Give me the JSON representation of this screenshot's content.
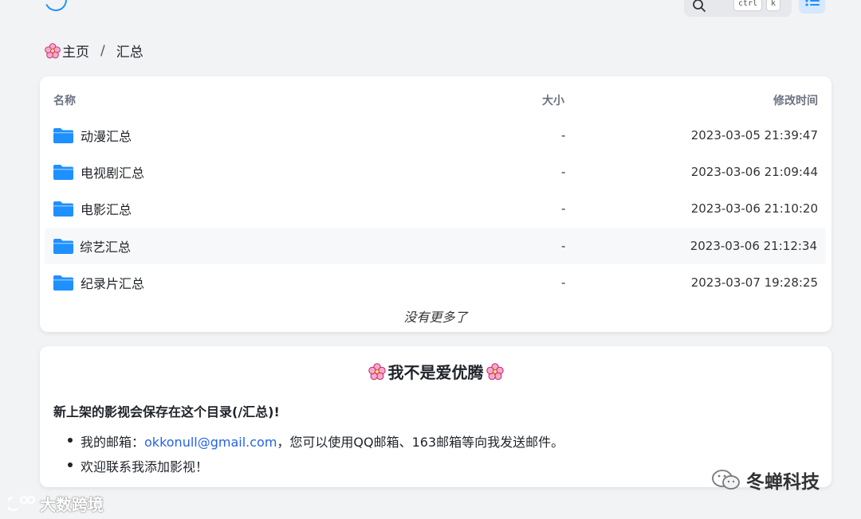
{
  "topbar": {
    "shortcut_keys": [
      "ctrl",
      "k"
    ]
  },
  "breadcrumb": {
    "home_label": "主页",
    "separator": "/",
    "current_label": "汇总"
  },
  "file_list": {
    "columns": {
      "name": "名称",
      "size": "大小",
      "modified": "修改时间"
    },
    "rows": [
      {
        "name": "动漫汇总",
        "size": "-",
        "modified": "2023-03-05 21:39:47",
        "icon": "folder-icon"
      },
      {
        "name": "电视剧汇总",
        "size": "-",
        "modified": "2023-03-06 21:09:44",
        "icon": "folder-icon"
      },
      {
        "name": "电影汇总",
        "size": "-",
        "modified": "2023-03-06 21:10:20",
        "icon": "folder-icon"
      },
      {
        "name": "综艺汇总",
        "size": "-",
        "modified": "2023-03-06 21:12:34",
        "icon": "folder-icon"
      },
      {
        "name": "纪录片汇总",
        "size": "-",
        "modified": "2023-03-07 19:28:25",
        "icon": "folder-icon"
      }
    ],
    "end_text": "没有更多了"
  },
  "readme": {
    "title": "我不是爱优腾",
    "lead": "新上架的影视会保存在这个目录(/汇总)!",
    "items": [
      {
        "prefix": "我的邮箱：",
        "link": "okkonull@gmail.com",
        "suffix": "，您可以使用QQ邮箱、163邮箱等向我发送邮件。"
      },
      {
        "text": "欢迎联系我添加影视！"
      }
    ]
  },
  "watermarks": {
    "right": "冬蝉科技",
    "left": "大数跨境"
  },
  "colors": {
    "background": "#f1f3f5",
    "accent": "#1e90ff",
    "link": "#2563eb",
    "folder": "#1e90ff"
  }
}
